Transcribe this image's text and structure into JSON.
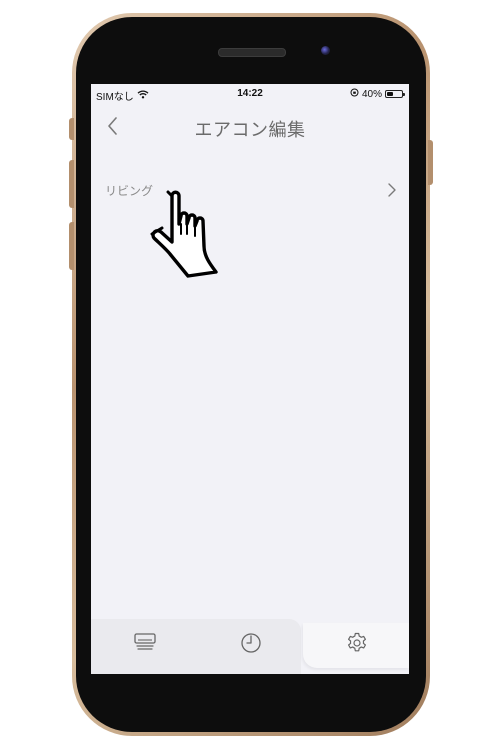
{
  "status_bar": {
    "carrier": "SIMなし",
    "time": "14:22",
    "battery_percent": "40%",
    "battery_level": 0.4
  },
  "header": {
    "title": "エアコン編集",
    "back_icon": "chevron-left-icon"
  },
  "list": {
    "items": [
      {
        "label": "リビング",
        "icon": "chevron-right-icon"
      }
    ]
  },
  "tab_bar": {
    "tabs": [
      {
        "icon": "aircon-icon",
        "active": false
      },
      {
        "icon": "timer-icon",
        "active": false
      },
      {
        "icon": "gear-icon",
        "active": true
      }
    ]
  },
  "overlay": {
    "icon": "pointing-hand-icon"
  },
  "colors": {
    "screen_background": "#f2f2f7",
    "text_gray": "#6b6b6b",
    "frame_gold": "#c8a584",
    "frame_black": "#0d0d0d"
  }
}
